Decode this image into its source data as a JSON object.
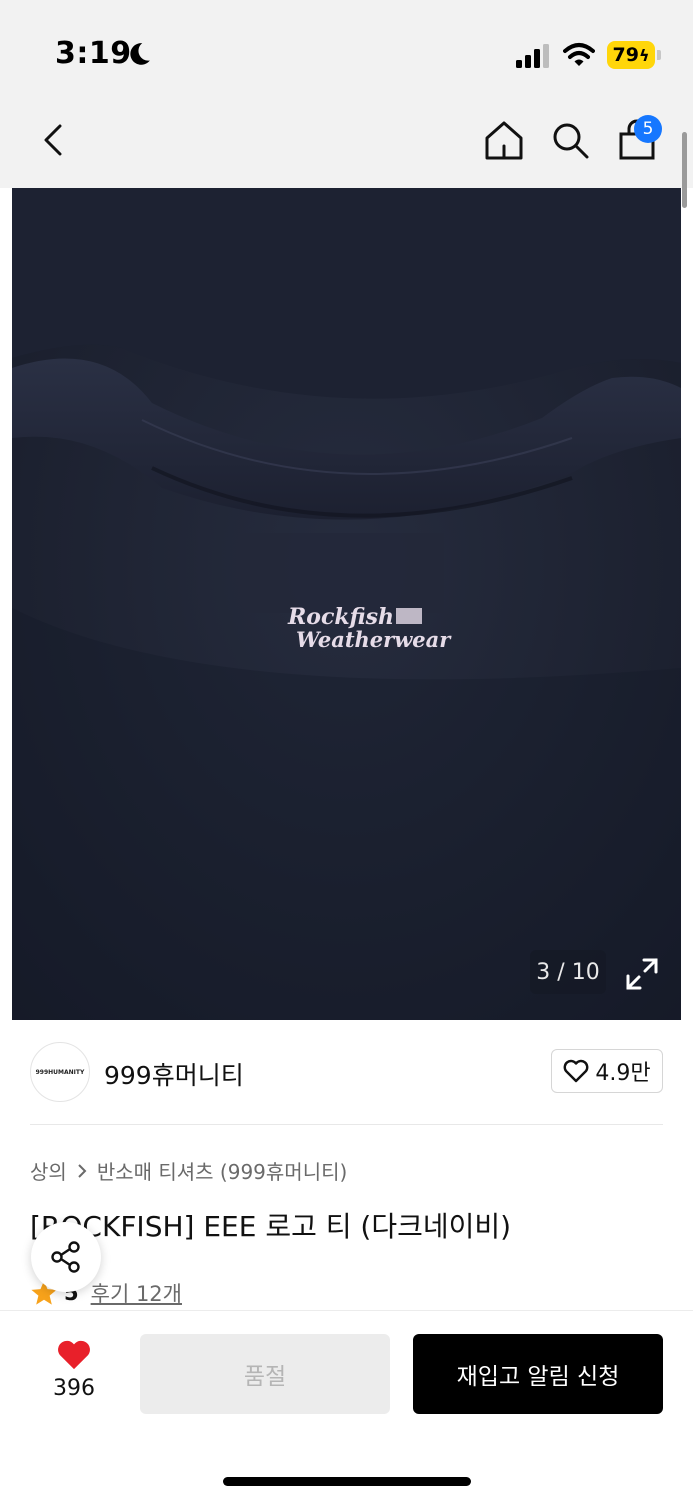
{
  "status_bar": {
    "time": "3:19",
    "battery": "79"
  },
  "nav": {
    "cart_badge": "5"
  },
  "gallery": {
    "counter": "3 / 10",
    "print_line1": "Rockfish",
    "print_line2": "Weatherwear"
  },
  "brand": {
    "logo_text": "999HUMANITY",
    "name": "999휴머니티",
    "likes": "4.9만"
  },
  "breadcrumb": {
    "items": [
      "상의",
      "반소매 티셔츠 (999휴머니티)"
    ]
  },
  "product": {
    "title": "[ROCKFISH] EEE 로고 티 (다크네이비)"
  },
  "rating": {
    "score": "5",
    "reviews": "후기 12개"
  },
  "bottom_bar": {
    "wishlist_count": "396",
    "soldout_label": "품절",
    "restock_label": "재입고 알림 신청"
  },
  "colors": {
    "accent_blue": "#1677ff",
    "heart_red": "#e8202a",
    "star_orange": "#f7a21b",
    "battery_yellow": "#ffd60a"
  }
}
